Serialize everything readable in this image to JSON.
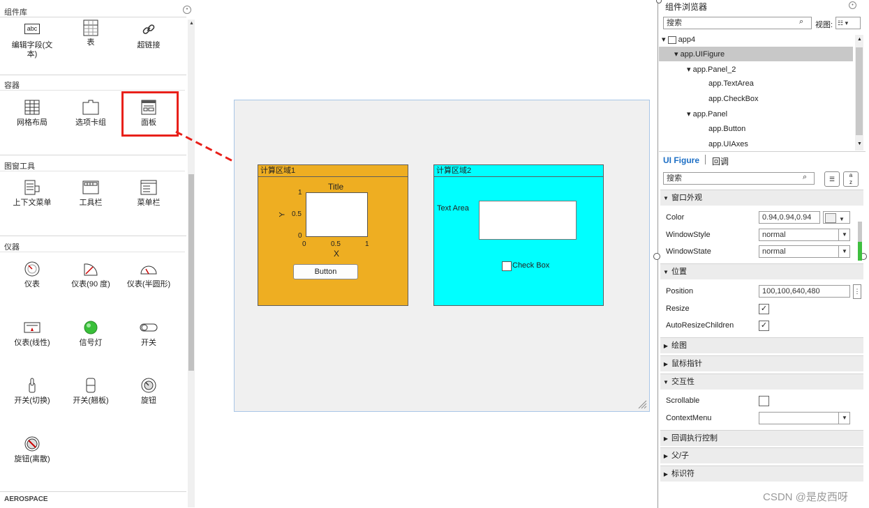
{
  "library": {
    "title": "组件库",
    "sections": {
      "container": "容器",
      "window_tools": "图窗工具",
      "instruments": "仪器",
      "aerospace": "AEROSPACE"
    },
    "items": {
      "edit_text": "编辑字段(文\n本)",
      "table": "表",
      "hyperlink": "超链接",
      "grid_layout": "网格布局",
      "tab_group": "选项卡组",
      "panel": "面板",
      "context_menu": "上下文菜单",
      "toolbar": "工具栏",
      "menubar": "菜单栏",
      "gauge": "仪表",
      "gauge90": "仪表(90 度)",
      "gauge_semi": "仪表(半圆形)",
      "gauge_linear": "仪表(线性)",
      "lamp": "信号灯",
      "switch": "开关",
      "switch_toggle": "开关(切换)",
      "switch_rocker": "开关(翘板)",
      "knob": "旋钮",
      "knob_discrete": "旋钮(离散)"
    },
    "icon_text": {
      "abc": "abc",
      "table": "1 2 3"
    }
  },
  "canvas": {
    "panel1": {
      "title": "计算区域1",
      "axes": {
        "title": "Title",
        "xlabel": "X",
        "ylabel": "Y",
        "xticks": [
          "0",
          "0.5",
          "1"
        ],
        "yticks": [
          "1",
          "0.5",
          "0"
        ]
      },
      "button_label": "Button"
    },
    "panel2": {
      "title": "计算区域2",
      "textarea_label": "Text Area",
      "checkbox_label": "Check Box"
    }
  },
  "browser": {
    "title": "组件浏览器",
    "search_placeholder": "搜索",
    "view_label": "视图:",
    "tree": {
      "root": "app4",
      "figure": "app.UIFigure",
      "panel2": "app.Panel_2",
      "textarea": "app.TextArea",
      "checkbox": "app.CheckBox",
      "panel": "app.Panel",
      "button": "app.Button",
      "axes": "app.UIAxes"
    }
  },
  "inspector": {
    "tab_active": "UI Figure",
    "tab_other": "回调",
    "search_placeholder": "搜索",
    "sections": {
      "appearance": "窗口外观",
      "position": "位置",
      "plotting": "绘图",
      "pointer": "鼠标指针",
      "interactivity": "交互性",
      "callback_exec": "回调执行控制",
      "parent_child": "父/子",
      "identifiers": "标识符"
    },
    "props": {
      "color_label": "Color",
      "color_value": "0.94,0.94,0.94",
      "windowstyle_label": "WindowStyle",
      "windowstyle_value": "normal",
      "windowstate_label": "WindowState",
      "windowstate_value": "normal",
      "position_label": "Position",
      "position_value": "100,100,640,480",
      "resize_label": "Resize",
      "autoresize_label": "AutoResizeChildren",
      "scrollable_label": "Scrollable",
      "contextmenu_label": "ContextMenu"
    },
    "checks": {
      "resize": "✓",
      "autoresize": "✓"
    }
  },
  "watermark": "CSDN @是皮西呀",
  "colors": {
    "panel1_bg": "#eeae22",
    "panel2_bg": "#00ffff",
    "highlight": "#e8201a"
  }
}
